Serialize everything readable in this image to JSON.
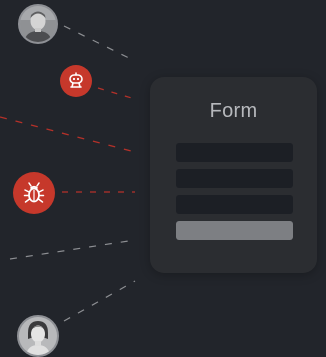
{
  "form": {
    "title": "Form",
    "fields": 3
  },
  "nodes": {
    "user_top": "user-avatar",
    "bot": "robot-icon",
    "bug": "bug-icon",
    "user_bottom": "user-avatar"
  },
  "colors": {
    "background": "#22252b",
    "card": "#2b2d31",
    "field": "#1c1f25",
    "submit": "#7d7f83",
    "threat": "#c6382b",
    "threat_link": "#b53129",
    "safe_link": "#8d8f93"
  }
}
